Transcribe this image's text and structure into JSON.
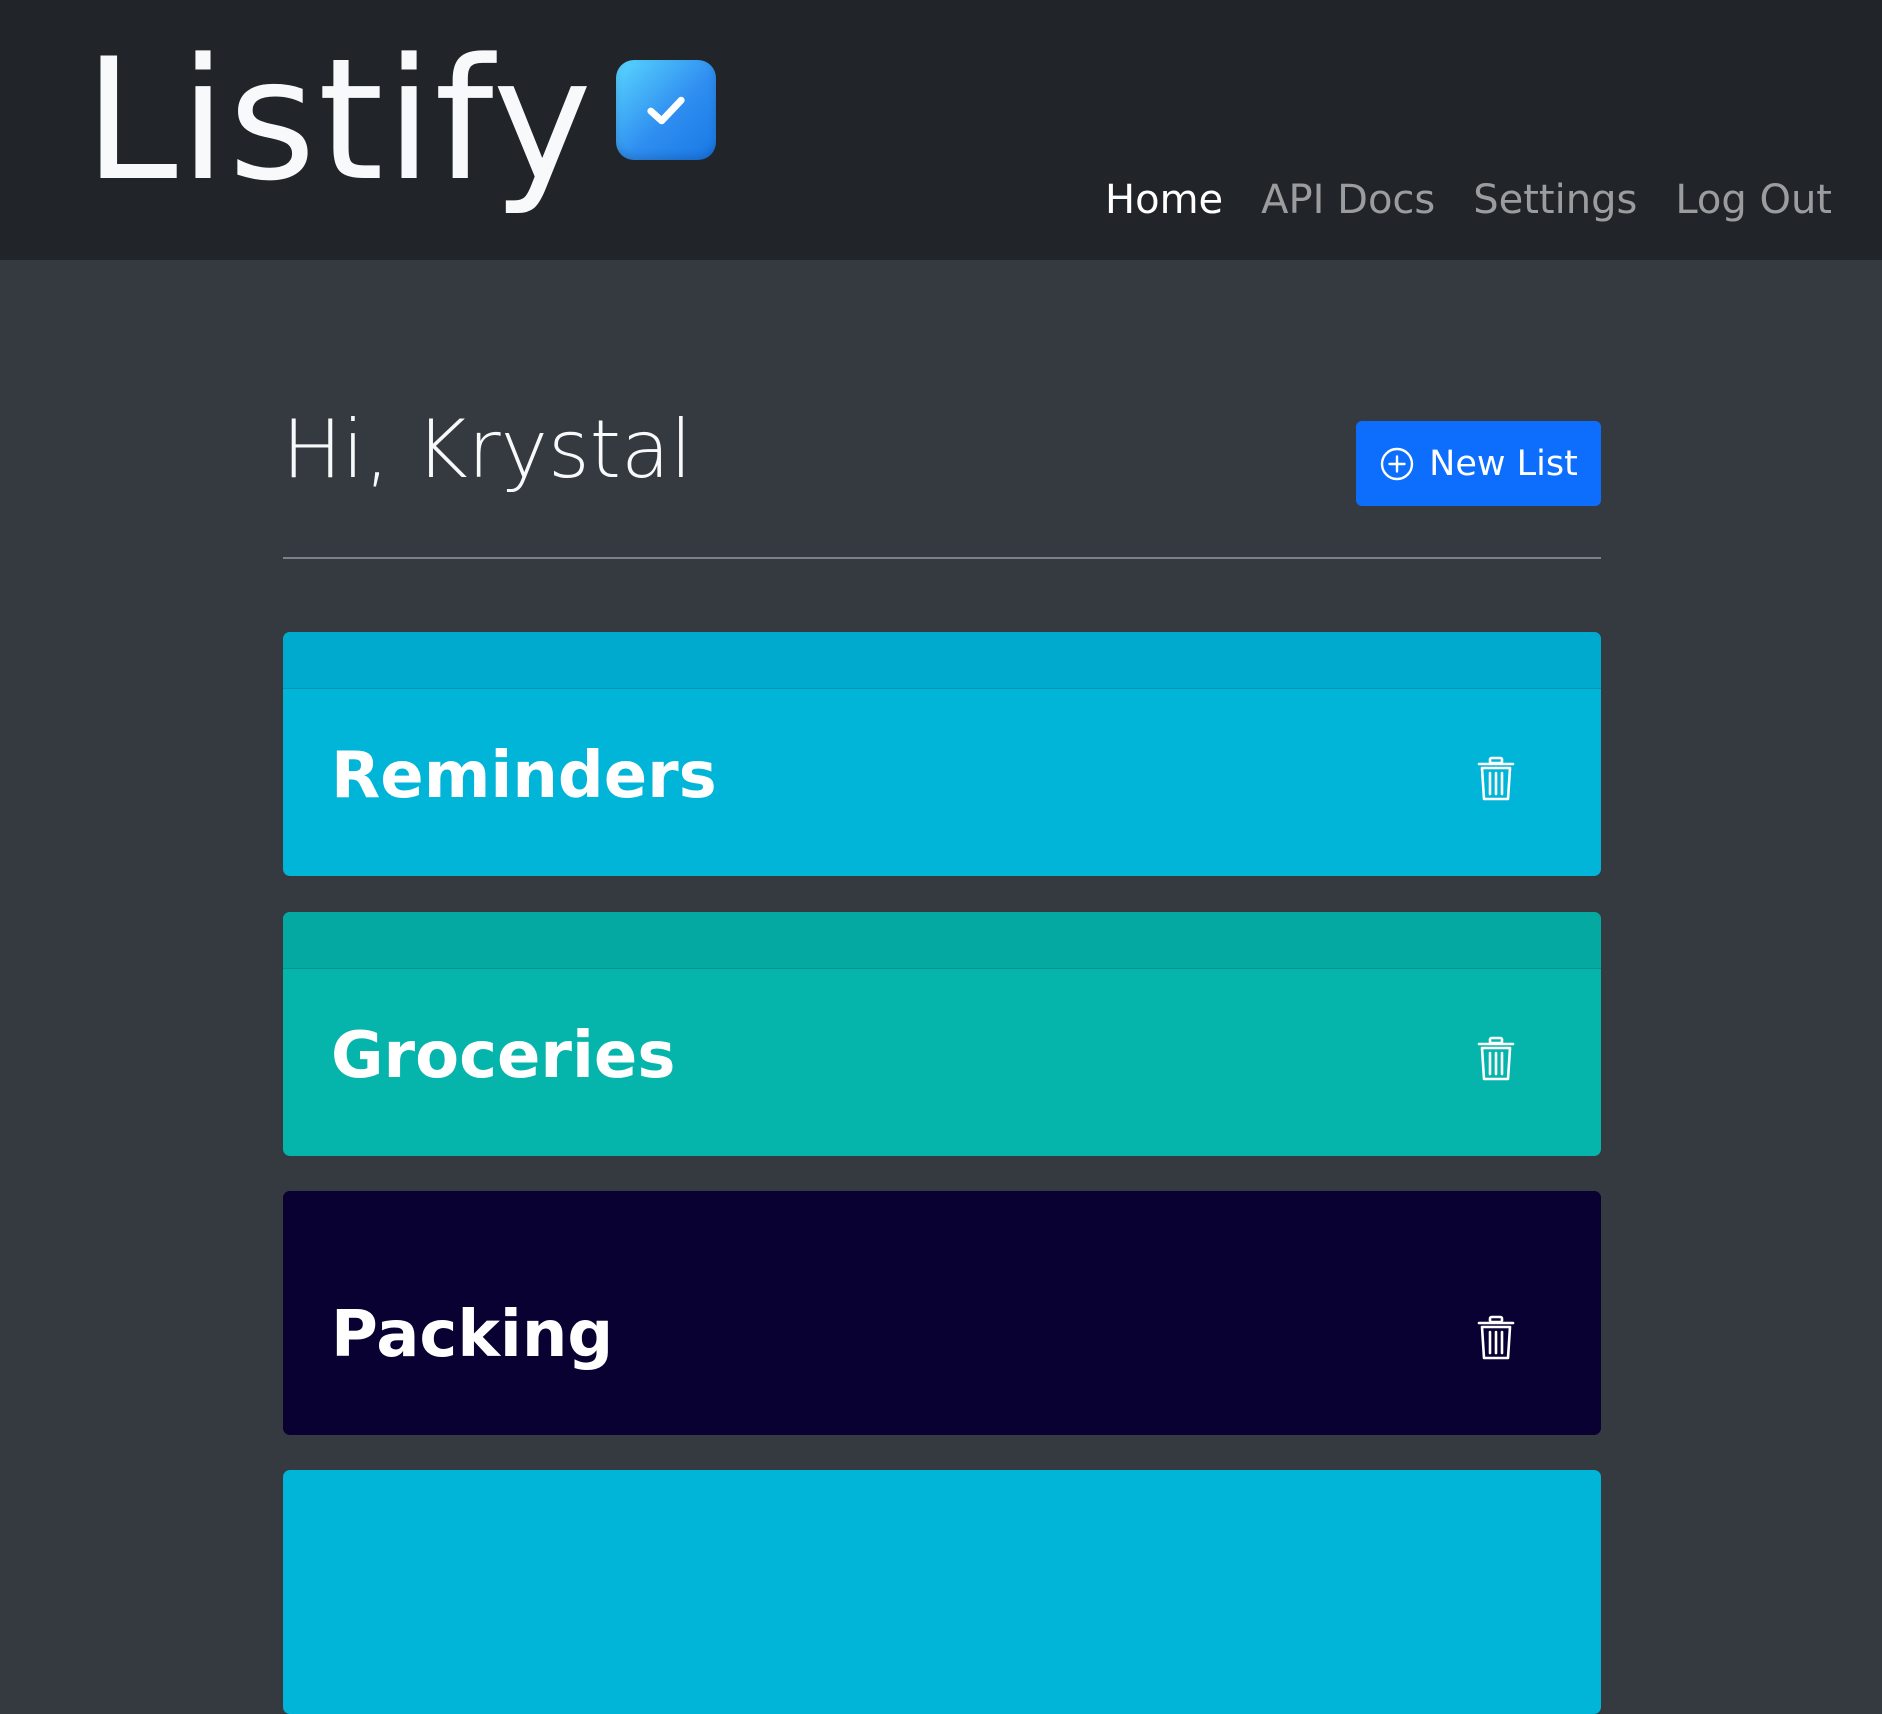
{
  "app": {
    "name": "Listify",
    "logo_icon": "check-square-icon"
  },
  "nav": {
    "links": [
      {
        "label": "Home",
        "active": true
      },
      {
        "label": "API Docs",
        "active": false
      },
      {
        "label": "Settings",
        "active": false
      },
      {
        "label": "Log Out",
        "active": false
      }
    ]
  },
  "main": {
    "greeting": "Hi, Krystal",
    "new_list_label": "New List",
    "new_list_icon": "plus-circle-icon"
  },
  "lists": [
    {
      "title": "Reminders",
      "color": "#00b5d7",
      "delete_icon": "trash-icon"
    },
    {
      "title": "Groceries",
      "color": "#05b4aa",
      "delete_icon": "trash-icon"
    },
    {
      "title": "Packing",
      "color": "#0a0133",
      "delete_icon": "trash-icon"
    },
    {
      "title": "",
      "color": "#00b5d7"
    }
  ],
  "colors": {
    "navbar": "#212529",
    "background": "#343a40",
    "primary": "#0d6efd"
  }
}
